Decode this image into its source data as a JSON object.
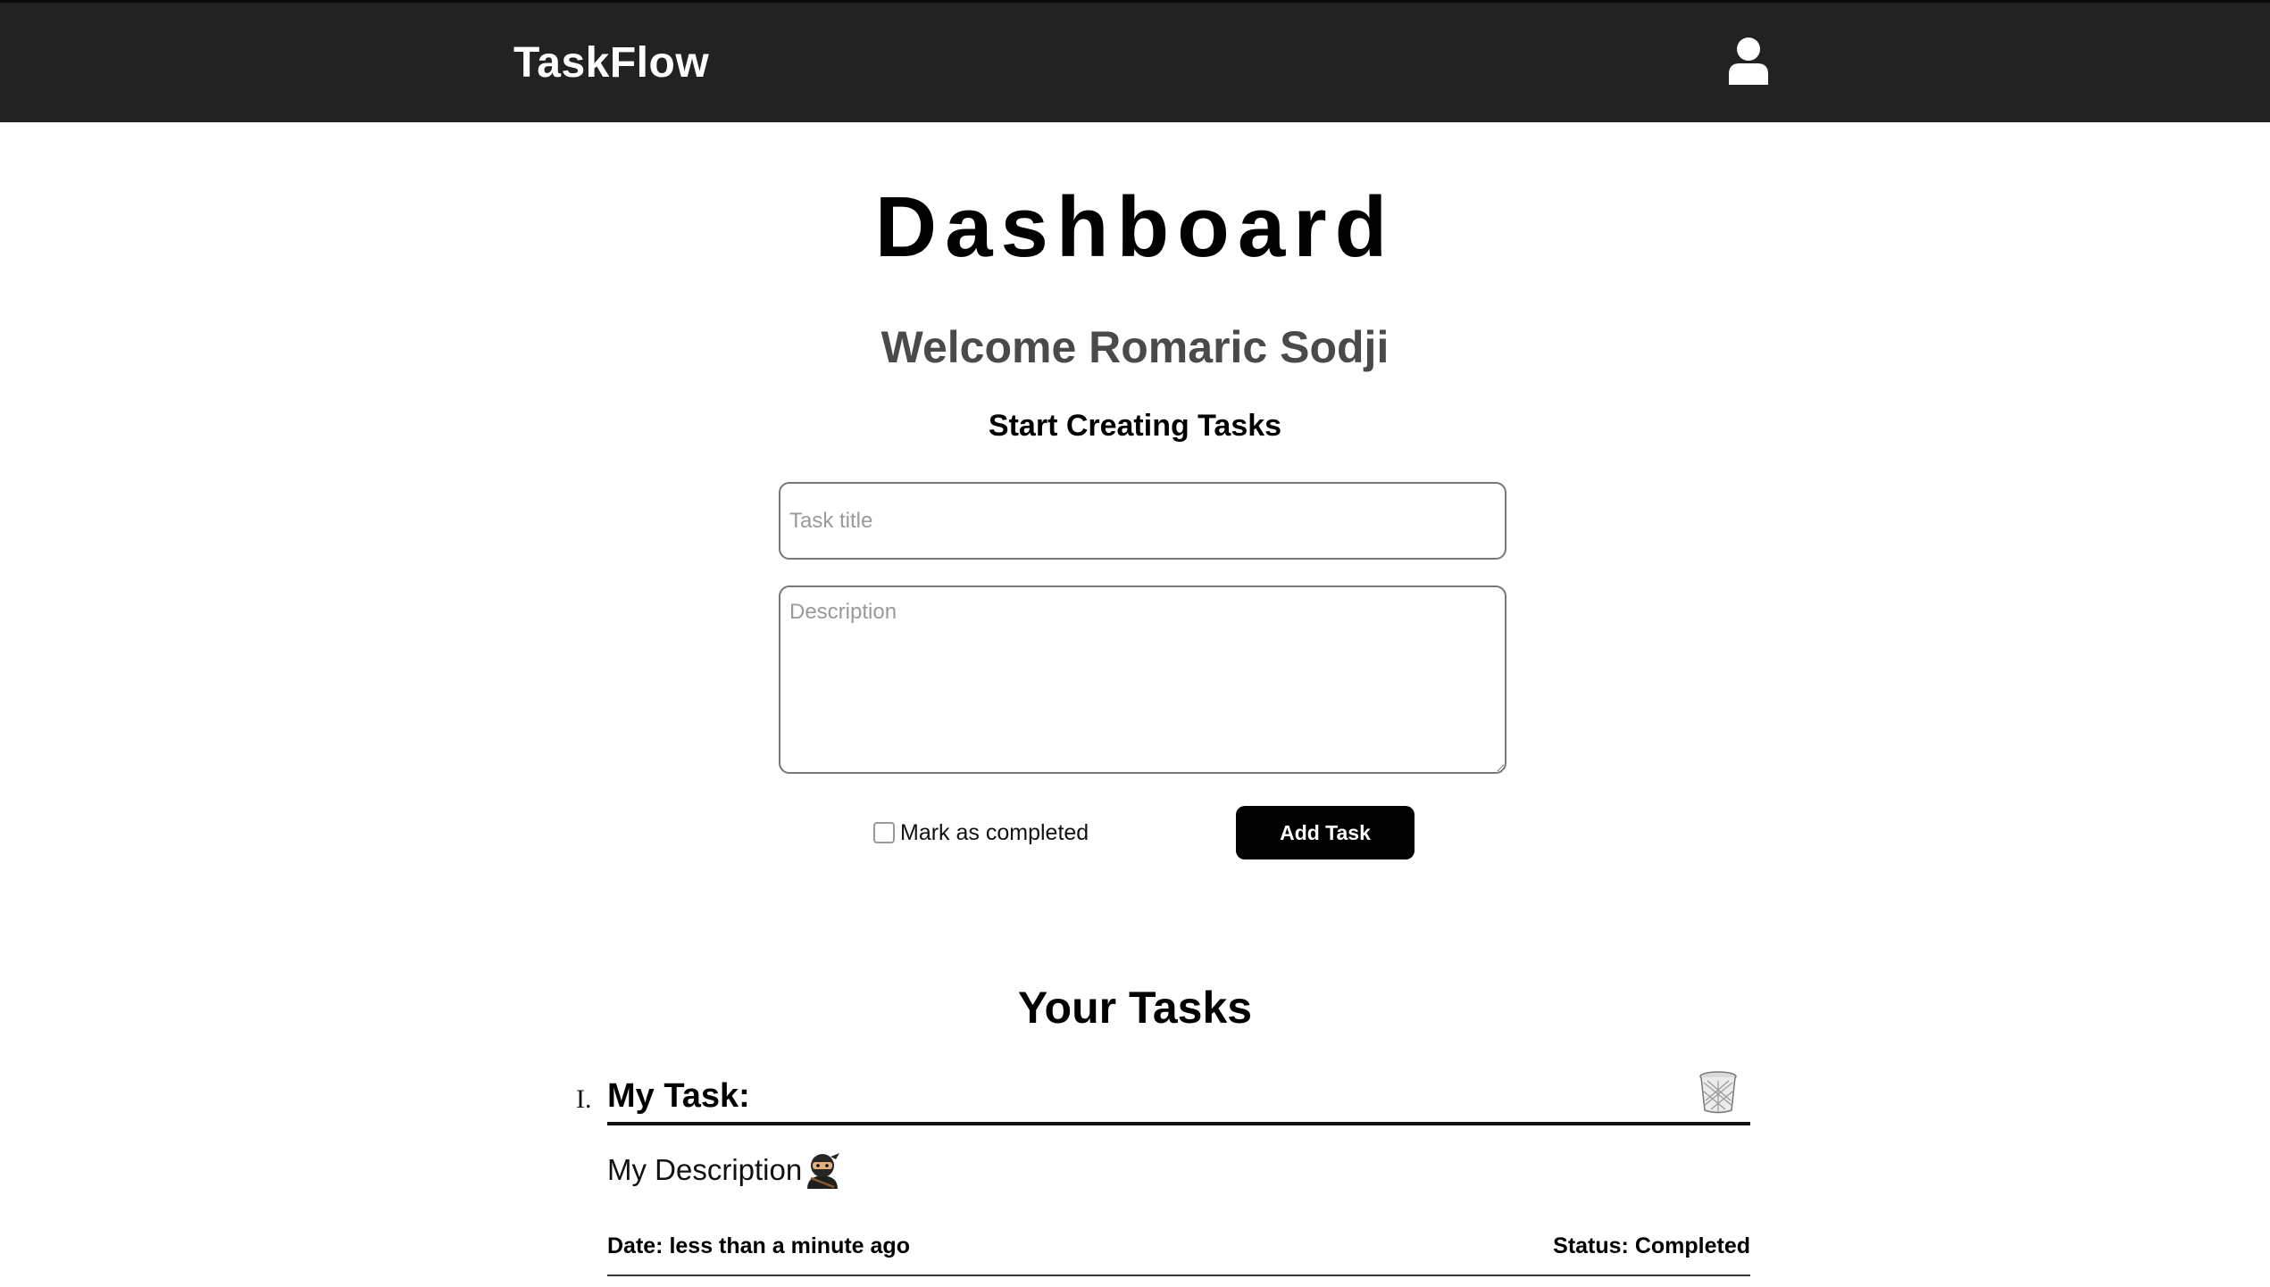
{
  "navbar": {
    "brand": "TaskFlow",
    "user_icon": "user-icon"
  },
  "page": {
    "title": "Dashboard",
    "welcome": "Welcome Romaric Sodji",
    "subtitle": "Start Creating Tasks"
  },
  "form": {
    "title_placeholder": "Task title",
    "title_value": "",
    "description_placeholder": "Description",
    "description_value": "",
    "completed_label": "Mark as completed",
    "completed_checked": false,
    "add_button_label": "Add Task"
  },
  "tasks_section": {
    "heading": "Your Tasks",
    "tasks": [
      {
        "marker": "I.",
        "title": "My Task:",
        "description": "My Description",
        "description_icon": "ninja-emoji-icon",
        "date": "Date: less than a minute ago",
        "status": "Status: Completed",
        "delete_icon": "trash-icon"
      }
    ]
  },
  "colors": {
    "navbar_bg": "#222222",
    "button_bg": "#000000",
    "welcome_text": "#4a4a4a"
  }
}
